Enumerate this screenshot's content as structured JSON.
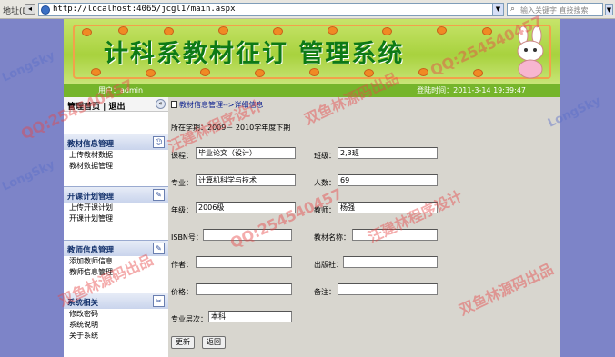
{
  "browser": {
    "addr_label": "地址(D)",
    "url": "http://localhost:4065/jcgl1/main.aspx",
    "search_placeholder": "输入关键字 直接搜索"
  },
  "banner": {
    "title": "计科系教材征订  管理系统"
  },
  "userbar": {
    "user_label": "用户：admin",
    "login_time": "登陆时间：2011-3-14 19:39:47"
  },
  "sidebar": {
    "home": "管理首页 | 退出",
    "sections": [
      {
        "title": "教材信息管理",
        "items": [
          "上传教材数据",
          "教材数据管理"
        ]
      },
      {
        "title": "开课计划管理",
        "items": [
          "上传开课计划",
          "开课计划管理"
        ]
      },
      {
        "title": "教师信息管理",
        "items": [
          "添加教师信息",
          "教师信息管理"
        ]
      },
      {
        "title": "系统相关",
        "items": [
          "修改密码",
          "系统说明",
          "关于系统"
        ]
      }
    ]
  },
  "main": {
    "breadcrumb": "教材信息管理-->详细信息",
    "term": "所在学期：2009－ 2010学年度下期",
    "form": {
      "course_label": "课程：",
      "course_value": "毕业论文（设计）",
      "class_label": "班级：",
      "class_value": "2,3班",
      "major_label": "专业：",
      "major_value": "计算机科学与技术",
      "count_label": "人数：",
      "count_value": "69",
      "grade_label": "年级：",
      "grade_value": "2006级",
      "teacher_label": "教师：",
      "teacher_value": "杨强",
      "isbn_label": "ISBN号：",
      "isbn_value": "",
      "bookname_label": "教材名称：",
      "bookname_value": "",
      "author_label": "作者：",
      "author_value": "",
      "publisher_label": "出版社：",
      "publisher_value": "",
      "price_label": "价格：",
      "price_value": "",
      "remark_label": "备注：",
      "remark_value": "",
      "level_label": "专业层次：",
      "level_value": "本科"
    },
    "update_button": "更新",
    "back_button": "返回"
  },
  "watermark": {
    "line1": "LongSky",
    "line2": "QQ:254540457",
    "line3": "汪建林程序设计",
    "line4": "双鱼林源码出品"
  }
}
